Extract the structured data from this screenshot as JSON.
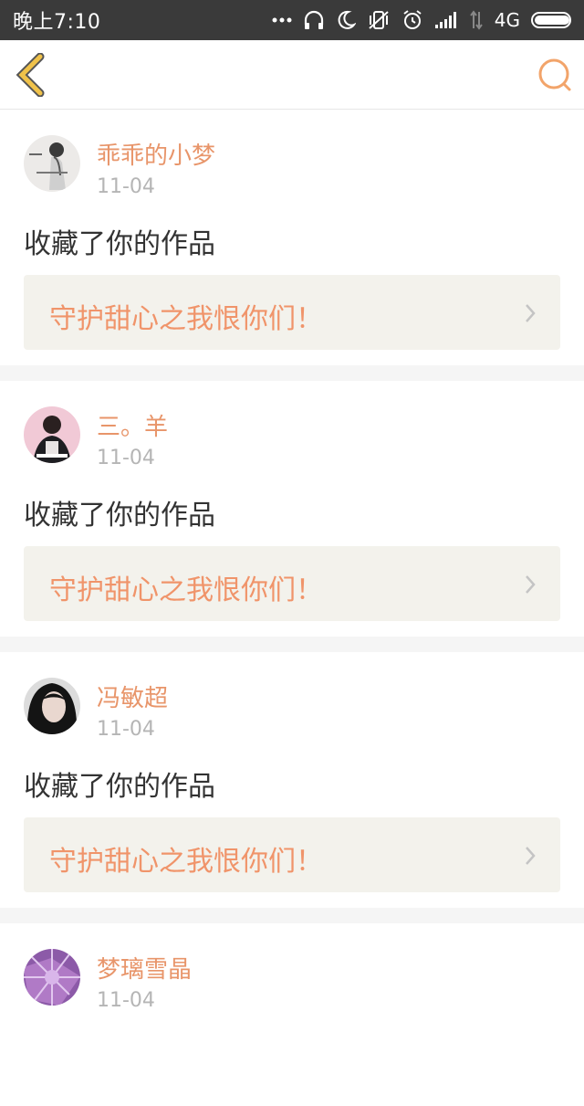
{
  "status_bar": {
    "time": "晚上7:10",
    "network": "4G",
    "icons": [
      "more-dots-icon",
      "headphones-icon",
      "moon-icon",
      "mute-vibrate-icon",
      "alarm-icon",
      "signal-icon",
      "data-arrows-icon",
      "battery-icon"
    ]
  },
  "nav": {
    "back_icon": "chevron-left-icon",
    "search_icon": "search-icon",
    "accent_color": "#f0c24a"
  },
  "notifications": [
    {
      "username": "乖乖的小梦",
      "date": "11-04",
      "action": "收藏了你的作品",
      "work_title": "守护甜心之我恨你们！",
      "avatar": "avatar-girl-sketch"
    },
    {
      "username": "三。羊",
      "date": "11-04",
      "action": "收藏了你的作品",
      "work_title": "守护甜心之我恨你们！",
      "avatar": "avatar-pink-poster"
    },
    {
      "username": "冯敏超",
      "date": "11-04",
      "action": "收藏了你的作品",
      "work_title": "守护甜心之我恨你们！",
      "avatar": "avatar-portrait"
    },
    {
      "username": "梦璃雪晶",
      "date": "11-04",
      "avatar": "avatar-purple-flowers"
    }
  ],
  "colors": {
    "username": "#e8956a",
    "work_title": "#f0946a",
    "date": "#b5b5b5",
    "card_link_bg": "#f3f2ec"
  }
}
